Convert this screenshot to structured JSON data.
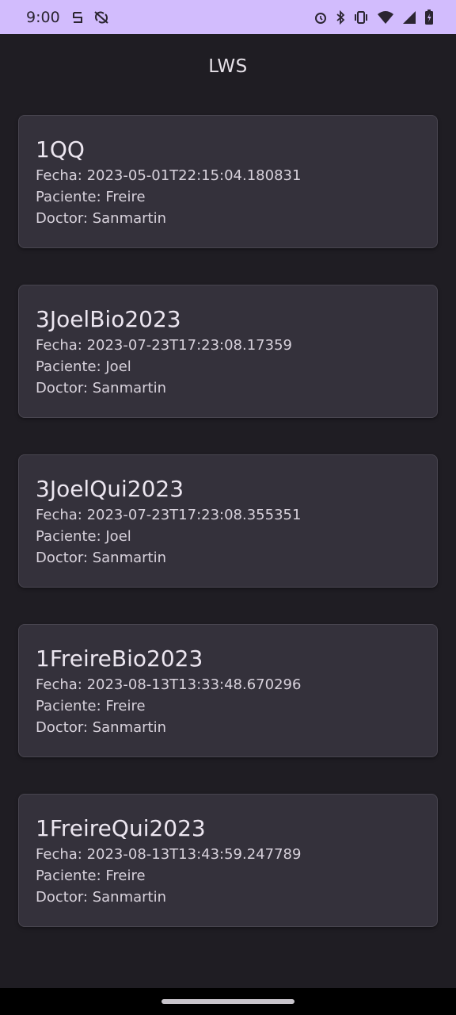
{
  "status_bar": {
    "time": "9:00",
    "colors": {
      "background": "#d2bcfd",
      "foreground": "#2b2531"
    }
  },
  "app_bar": {
    "title": "LWS"
  },
  "records": [
    {
      "title": "1QQ",
      "fecha": "Fecha: 2023-05-01T22:15:04.180831",
      "paciente": "Paciente: Freire",
      "doctor": "Doctor: Sanmartin"
    },
    {
      "title": "3JoelBio2023",
      "fecha": "Fecha: 2023-07-23T17:23:08.17359",
      "paciente": "Paciente: Joel",
      "doctor": "Doctor: Sanmartin"
    },
    {
      "title": "3JoelQui2023",
      "fecha": "Fecha: 2023-07-23T17:23:08.355351",
      "paciente": "Paciente: Joel",
      "doctor": "Doctor: Sanmartin"
    },
    {
      "title": "1FreireBio2023",
      "fecha": "Fecha: 2023-08-13T13:33:48.670296",
      "paciente": "Paciente: Freire",
      "doctor": "Doctor: Sanmartin"
    },
    {
      "title": "1FreireQui2023",
      "fecha": "Fecha: 2023-08-13T13:43:59.247789",
      "paciente": "Paciente: Freire",
      "doctor": "Doctor: Sanmartin"
    }
  ],
  "theme": {
    "background": "#1f1d23",
    "card": "#34313b",
    "text": "#e6e1e8"
  }
}
